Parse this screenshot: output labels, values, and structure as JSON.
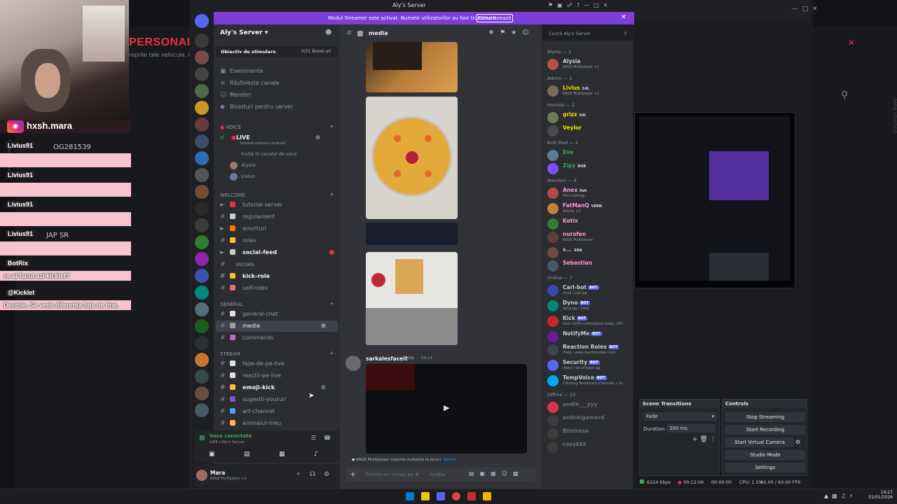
{
  "background_page": {
    "heading": "PERSONAL",
    "subtitle": "roprile tale vehicule. D",
    "side_text": "GARAJ VEHICULE"
  },
  "overlay": {
    "ig_handle": "hxsh.mara",
    "ig_icon": "instagram-icon",
    "chat": [
      {
        "user": "Livius91",
        "msg": "",
        "side": "OG281539"
      },
      {
        "user": "Livius91",
        "msg": "",
        "side": ""
      },
      {
        "user": "Livius91",
        "msg": "",
        "side": ""
      },
      {
        "user": "Livius91",
        "msg": "",
        "side": "JAP SR"
      },
      {
        "user": "BotRix",
        "msg": "ce ai facut azi kicklet?",
        "side": ""
      },
      {
        "user": "@Kicklet",
        "msg": "Destule. Se vede diferența fața de tine.",
        "side": ""
      }
    ]
  },
  "discord": {
    "window_title": "Aly's Server",
    "banner": {
      "text": "Modul Streamer este activat. Numele utilizatorilor au fost trunchiate.",
      "button": "Dezactivează"
    },
    "server_name": "Aly's Server",
    "boost": {
      "label": "Obiectiv de stimulare",
      "count": "0/31 Boost-uri"
    },
    "top_links": [
      "Evenimente",
      "Răsfoiește canale",
      "Membri",
      "Boosturi pentru server"
    ],
    "voice_category": "VOICE",
    "voice_channel": "LIVE",
    "voice_status_hint": "Setează statusul canalului",
    "voice_invite": "Invită în canalul de voce",
    "voice_users": [
      "Alysia",
      "Livius"
    ],
    "categories": {
      "welcome": "WELCOME",
      "general": "GENERAL",
      "stream": "STREAM"
    },
    "welcome_channels": [
      "tutorial-server",
      "regulament",
      "anunturi",
      "roles",
      "social-feed",
      "socials",
      "kick-role",
      "self-roles"
    ],
    "general_channels": [
      "general-chat",
      "media",
      "commands"
    ],
    "stream_channels": [
      "faze-de-pe-live",
      "reactii-pe-live",
      "emoji-kick",
      "sugestii-youruri",
      "art-channel",
      "animalul-meu"
    ],
    "voice_connected": {
      "title": "Voce conectată",
      "sub": "LIVE / Aly's Server"
    },
    "user": {
      "name": "Mara",
      "status": "RAGE Multiplayer +1"
    },
    "current_channel": "media",
    "search_placeholder": "Caută Aly's Server",
    "message": {
      "author": "sarkalesfaceit",
      "tag": "W2G",
      "time": "03:14"
    },
    "rage_notice": "RAGE Multiplayer suportă invitațiile la jocuri.",
    "rage_link": "Ignoră",
    "input_placeholder": "Trimite un mesaj pe #",
    "input_channel": "media",
    "members": [
      {
        "cat": "Alysia — 1",
        "items": [
          {
            "name": "Alysia",
            "status": "RAGE Multiplayer +1",
            "color": "#c9ccd1"
          }
        ]
      },
      {
        "cat": "Admin — 1",
        "items": [
          {
            "name": "Livius",
            "tag": "S4L",
            "status": "RAGE Multiplayer +1",
            "color": "#f0e000"
          }
        ]
      },
      {
        "cat": "Homies — 2",
        "items": [
          {
            "name": "grizz",
            "tag": "S4L",
            "status": "",
            "color": "#f0e000"
          },
          {
            "name": "Veylor",
            "status": "",
            "color": "#f0e000"
          }
        ]
      },
      {
        "cat": "Kick Mod — 2",
        "items": [
          {
            "name": "Eve",
            "status": "",
            "color": "#3ba55d"
          },
          {
            "name": "Zipy",
            "tag": "RHR",
            "status": "",
            "color": "#3ba55d"
          }
        ]
      },
      {
        "cat": "Membru — 6",
        "items": [
          {
            "name": "Anex",
            "tag": "fish",
            "status": "He's coming...",
            "color": "#ff9ad5"
          },
          {
            "name": "FatManQ",
            "tag": "VERN",
            "status": "Roblox +1",
            "color": "#ff9ad5"
          },
          {
            "name": "Kotix",
            "status": "",
            "color": "#ff9ad5"
          },
          {
            "name": "nurofen",
            "status": "RAGE Multiplayer",
            "color": "#ff9ad5"
          },
          {
            "name": "s...",
            "tag": "SOA",
            "status": "",
            "color": "#ff9ad5"
          },
          {
            "name": "Sebastian",
            "status": "",
            "color": "#ff9ad5"
          }
        ]
      },
      {
        "cat": "Online — 7",
        "items": [
          {
            "name": "Carl-bot",
            "bot": "BOT",
            "status": "/help | carl.gg",
            "color": "#c9ccd1"
          },
          {
            "name": "Dyno",
            "bot": "BOT",
            "status": "dyno.gg | !help",
            "color": "#c9ccd1"
          },
          {
            "name": "Kick",
            "bot": "BOT",
            "status": "Sent 1059 notifications today. 297...",
            "color": "#c9ccd1"
          },
          {
            "name": "NotifyMe",
            "bot": "BOT",
            "status": "",
            "color": "#c9ccd1"
          },
          {
            "name": "Reaction Roles",
            "bot": "BOT",
            "status": "/help | www.reactionroles.com",
            "color": "#c9ccd1"
          },
          {
            "name": "Security",
            "bot": "BOT",
            "status": "/help | securitybot.gg",
            "color": "#c9ccd1"
          },
          {
            "name": "TempVoice",
            "bot": "BOT",
            "status": "Creating Temporary Channels • /h...",
            "color": "#c9ccd1"
          }
        ]
      },
      {
        "cat": "Offline — 23",
        "items": [
          {
            "name": "andie___yyy",
            "status": "",
            "color": "#6d6f78"
          },
          {
            "name": "andreigamerd",
            "status": "",
            "color": "#6d6f78"
          },
          {
            "name": "Bimirasa",
            "status": "",
            "color": "#6d6f78"
          },
          {
            "name": "cozykkk",
            "status": "",
            "color": "#6d6f78"
          }
        ]
      }
    ]
  },
  "obs": {
    "scene_transitions": "Scene Transitions",
    "transition": "Fade",
    "duration_label": "Duration",
    "duration_value": "300 ms",
    "controls": "Controls",
    "buttons": [
      "Stop Streaming",
      "Start Recording",
      "Start Virtual Camera",
      "Studio Mode",
      "Settings"
    ],
    "status": {
      "bitrate": "6224 kbps",
      "live_time": "00:12:06",
      "rec_time": "00:00:00",
      "cpu": "CPU: 1.5%",
      "fps": "60.00 / 60.00 FPS"
    }
  },
  "taskbar": {
    "time": "14:27",
    "date": "01/01/2026"
  }
}
